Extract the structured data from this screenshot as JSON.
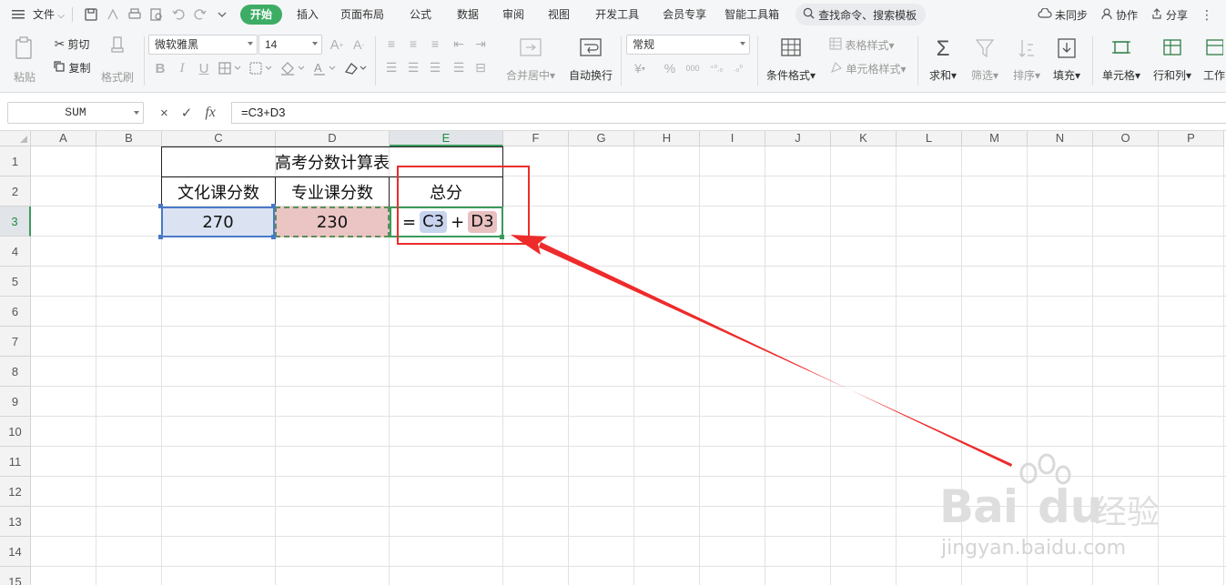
{
  "menubar": {
    "file_label": "文件",
    "tabs": [
      "开始",
      "插入",
      "页面布局",
      "公式",
      "数据",
      "审阅",
      "视图",
      "开发工具",
      "会员专享",
      "智能工具箱"
    ],
    "active_tab": "开始",
    "search_placeholder": "查找命令、搜索模板",
    "sync_label": "未同步",
    "collab_label": "协作",
    "share_label": "分享"
  },
  "ribbon": {
    "paste_label": "粘贴",
    "cut_label": "剪切",
    "copy_label": "复制",
    "format_painter_label": "格式刷",
    "font_name": "微软雅黑",
    "font_size": "14",
    "merge_label": "合并居中",
    "wrap_label": "自动换行",
    "number_format": "常规",
    "percent_symbol": "%",
    "currency_symbol": "¥",
    "thousands_symbol": "000",
    "cond_format_label": "条件格式",
    "table_style_label": "表格样式",
    "cell_style_label": "单元格样式",
    "sum_label": "求和",
    "filter_label": "筛选",
    "sort_label": "排序",
    "fill_label": "填充",
    "cell_label": "单元格",
    "rowcol_label": "行和列",
    "worksheet_label": "工作"
  },
  "formula_bar": {
    "name_box": "SUM",
    "cancel_symbol": "×",
    "confirm_symbol": "✓",
    "fx_label": "fx",
    "formula": "=C3+D3"
  },
  "grid": {
    "columns": [
      "A",
      "B",
      "C",
      "D",
      "E",
      "F",
      "G",
      "H",
      "I",
      "J",
      "K",
      "L",
      "M",
      "N",
      "O",
      "P"
    ],
    "rows": [
      "1",
      "2",
      "3",
      "4",
      "5",
      "6",
      "7",
      "8",
      "9",
      "10",
      "11",
      "12",
      "13",
      "14",
      "15"
    ],
    "selected_column": "E",
    "selected_row": "3"
  },
  "sheet": {
    "title": "高考分数计算表",
    "header_culture": "文化课分数",
    "header_major": "专业课分数",
    "header_total": "总分",
    "culture_score": "270",
    "major_score": "230",
    "edit_eq": "=",
    "edit_ref1": "C3",
    "edit_plus": "+",
    "edit_ref2": "D3"
  },
  "watermark": {
    "brand_left": "Bai",
    "brand_right": "du",
    "brand_cn": "经验",
    "url": "jingyan.baidu.com"
  },
  "colors": {
    "accent_green": "#3dad66",
    "annotation_red": "#ee2b2b",
    "ref_blue": "#dbe3f3",
    "ref_red": "#ebc4c4"
  }
}
